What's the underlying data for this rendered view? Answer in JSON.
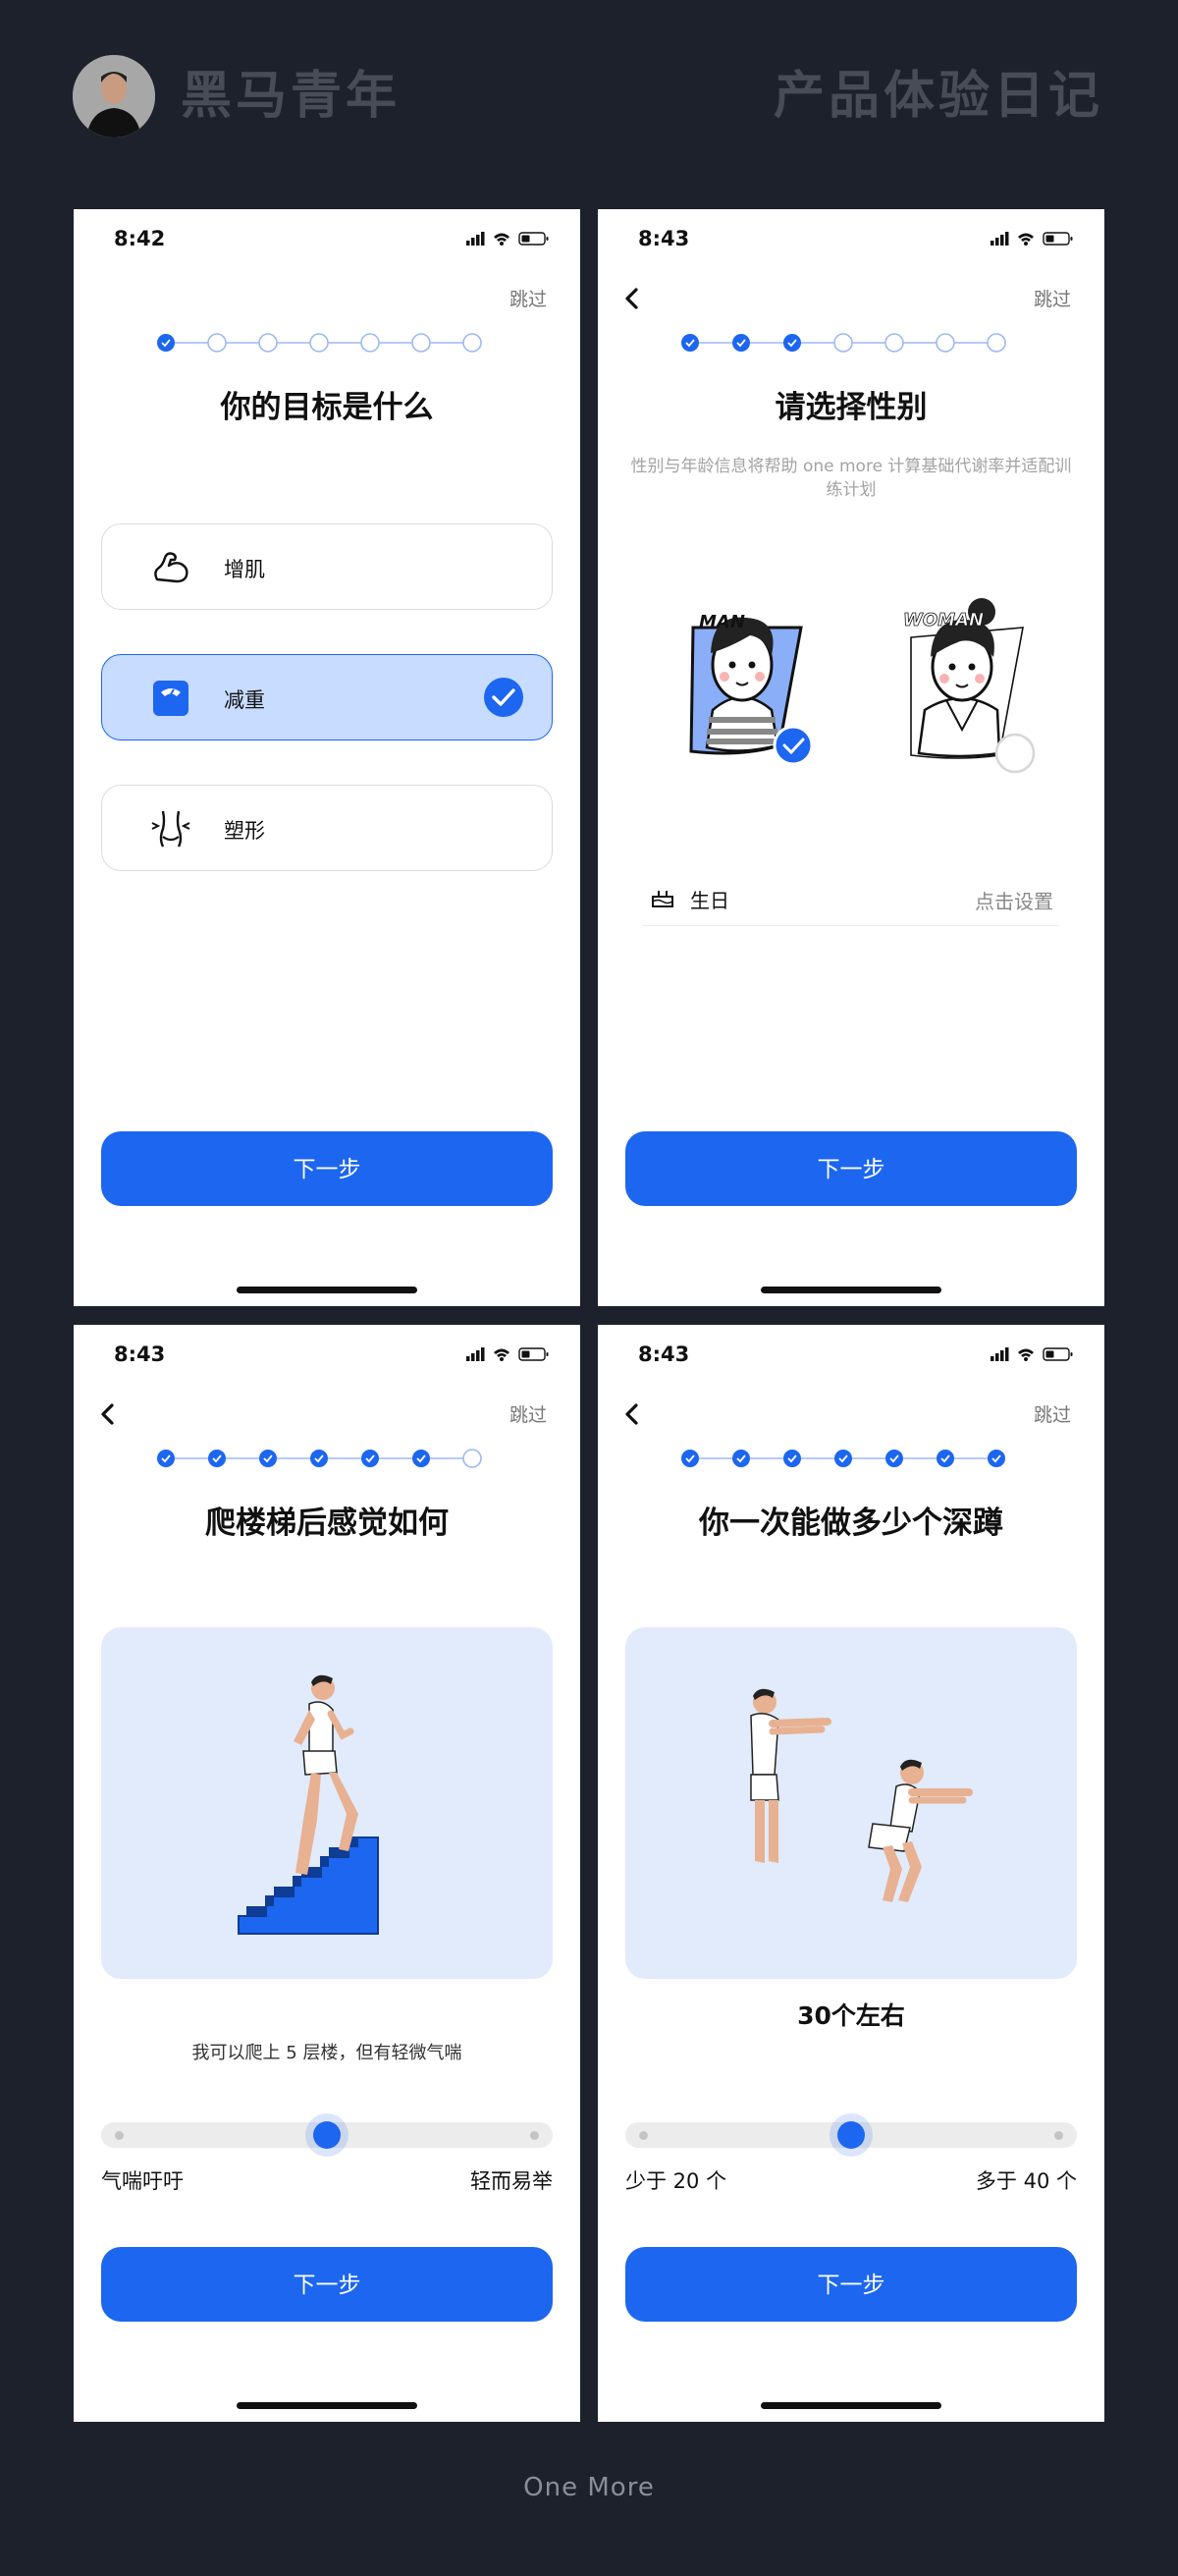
{
  "header": {
    "brand": "黑马青年",
    "title": "产品体验日记"
  },
  "footer": {
    "app_name": "One More"
  },
  "colors": {
    "accent": "#1c66f0",
    "selected_bg": "#c8dcff",
    "page_bg": "#1d212b",
    "illustration_bg": "#e1ebfb"
  },
  "screens": [
    {
      "time": "8:42",
      "skip_label": "跳过",
      "steps_total": 7,
      "steps_completed": 1,
      "title": "你的目标是什么",
      "options": [
        {
          "label": "增肌",
          "icon": "muscle-arm-icon",
          "selected": false
        },
        {
          "label": "减重",
          "icon": "scale-icon",
          "selected": true
        },
        {
          "label": "塑形",
          "icon": "body-shape-icon",
          "selected": false
        }
      ],
      "next_label": "下一步"
    },
    {
      "time": "8:43",
      "skip_label": "跳过",
      "steps_total": 7,
      "steps_completed": 3,
      "title": "请选择性别",
      "subtitle": "性别与年龄信息将帮助 one more 计算基础代谢率并适配训练计划",
      "genders": [
        {
          "label": "MAN",
          "selected": true
        },
        {
          "label": "WOMAN",
          "selected": false
        }
      ],
      "birthday_label": "生日",
      "birthday_action": "点击设置",
      "next_label": "下一步"
    },
    {
      "time": "8:43",
      "skip_label": "跳过",
      "steps_total": 7,
      "steps_completed": 6,
      "title": "爬楼梯后感觉如何",
      "hint": "我可以爬上 5 层楼，但有轻微气喘",
      "slider_min": "气喘吁吁",
      "slider_max": "轻而易举",
      "slider_position": 0.5,
      "next_label": "下一步"
    },
    {
      "time": "8:43",
      "skip_label": "跳过",
      "steps_total": 7,
      "steps_completed": 7,
      "title": "你一次能做多少个深蹲",
      "result": "30个左右",
      "slider_min": "少于 20 个",
      "slider_max": "多于 40 个",
      "slider_position": 0.5,
      "next_label": "下一步"
    }
  ]
}
